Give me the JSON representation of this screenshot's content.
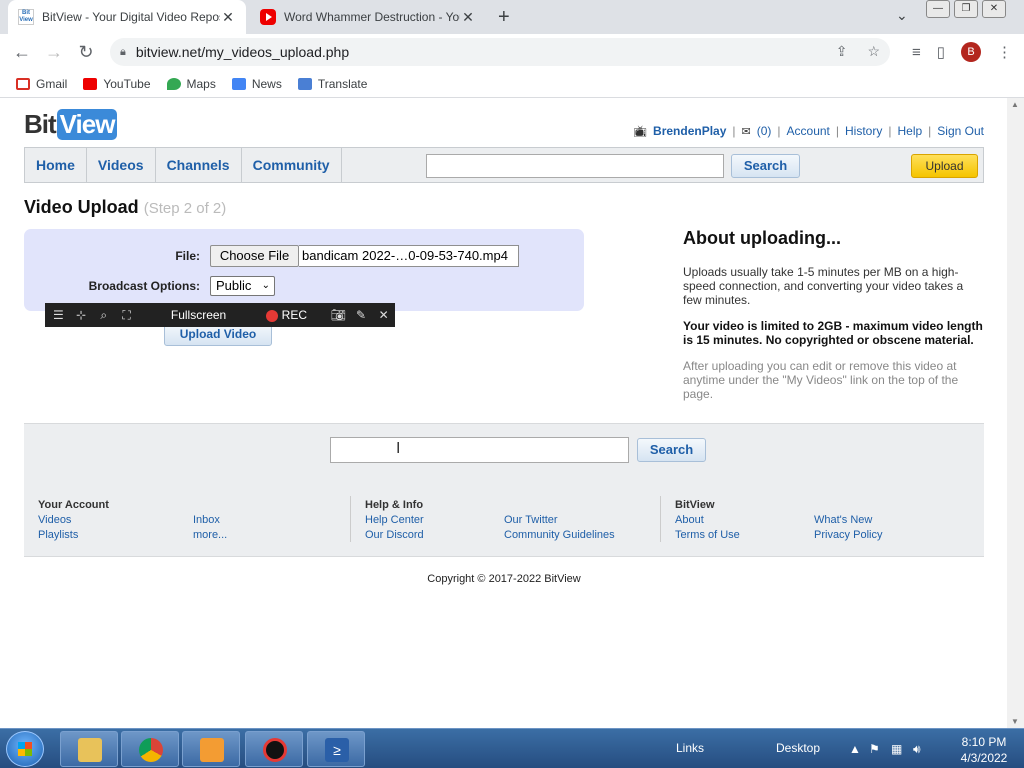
{
  "browser": {
    "tabs": [
      {
        "title": "BitView - Your Digital Video Repository",
        "active": true
      },
      {
        "title": "Word Whammer Destruction - YouTube",
        "active": false
      }
    ],
    "url": "bitview.net/my_videos_upload.php",
    "profile_initial": "B",
    "bookmarks": [
      "Gmail",
      "YouTube",
      "Maps",
      "News",
      "Translate"
    ]
  },
  "site": {
    "logo_bit": "Bit",
    "logo_view": "View",
    "user": {
      "username": "BrendenPlay",
      "inbox_count": "(0)",
      "links": [
        "Account",
        "History",
        "Help",
        "Sign Out"
      ]
    },
    "nav": [
      "Home",
      "Videos",
      "Channels",
      "Community"
    ],
    "search_label": "Search",
    "upload_label": "Upload"
  },
  "page": {
    "title": "Video Upload",
    "step": "(Step 2 of 2)",
    "file_label": "File:",
    "choose_file": "Choose File",
    "file_name": "bandicam 2022-…0-09-53-740.mp4",
    "broadcast_label": "Broadcast Options:",
    "broadcast_value": "Public",
    "upload_video_label": "Upload Video",
    "about": {
      "heading": "About uploading...",
      "p1": "Uploads usually take 1-5 minutes per MB on a high-speed connection, and converting your video takes a few minutes.",
      "p2": "Your video is limited to 2GB - maximum video length is 15 minutes. No copyrighted or obscene material.",
      "p3": "After uploading you can edit or remove this video at anytime under the \"My Videos\" link on the top of the page."
    }
  },
  "recorder": {
    "fullscreen": "Fullscreen",
    "rec": "REC"
  },
  "footer": {
    "search_label": "Search",
    "columns": [
      {
        "heading": "Your Account",
        "links": [
          "Videos",
          "Playlists"
        ]
      },
      {
        "heading": "",
        "links": [
          "Inbox",
          "more..."
        ]
      },
      {
        "heading": "Help & Info",
        "links": [
          "Help Center",
          "Our Discord"
        ]
      },
      {
        "heading": "",
        "links": [
          "Our Twitter",
          "Community Guidelines"
        ]
      },
      {
        "heading": "BitView",
        "links": [
          "About",
          "Terms of Use"
        ]
      },
      {
        "heading": "",
        "links": [
          "What's New",
          "Privacy Policy"
        ]
      }
    ],
    "copyright": "Copyright © 2017-2022 BitView"
  },
  "taskbar": {
    "links": "Links",
    "desktop": "Desktop",
    "time": "8:10 PM",
    "date": "4/3/2022"
  }
}
